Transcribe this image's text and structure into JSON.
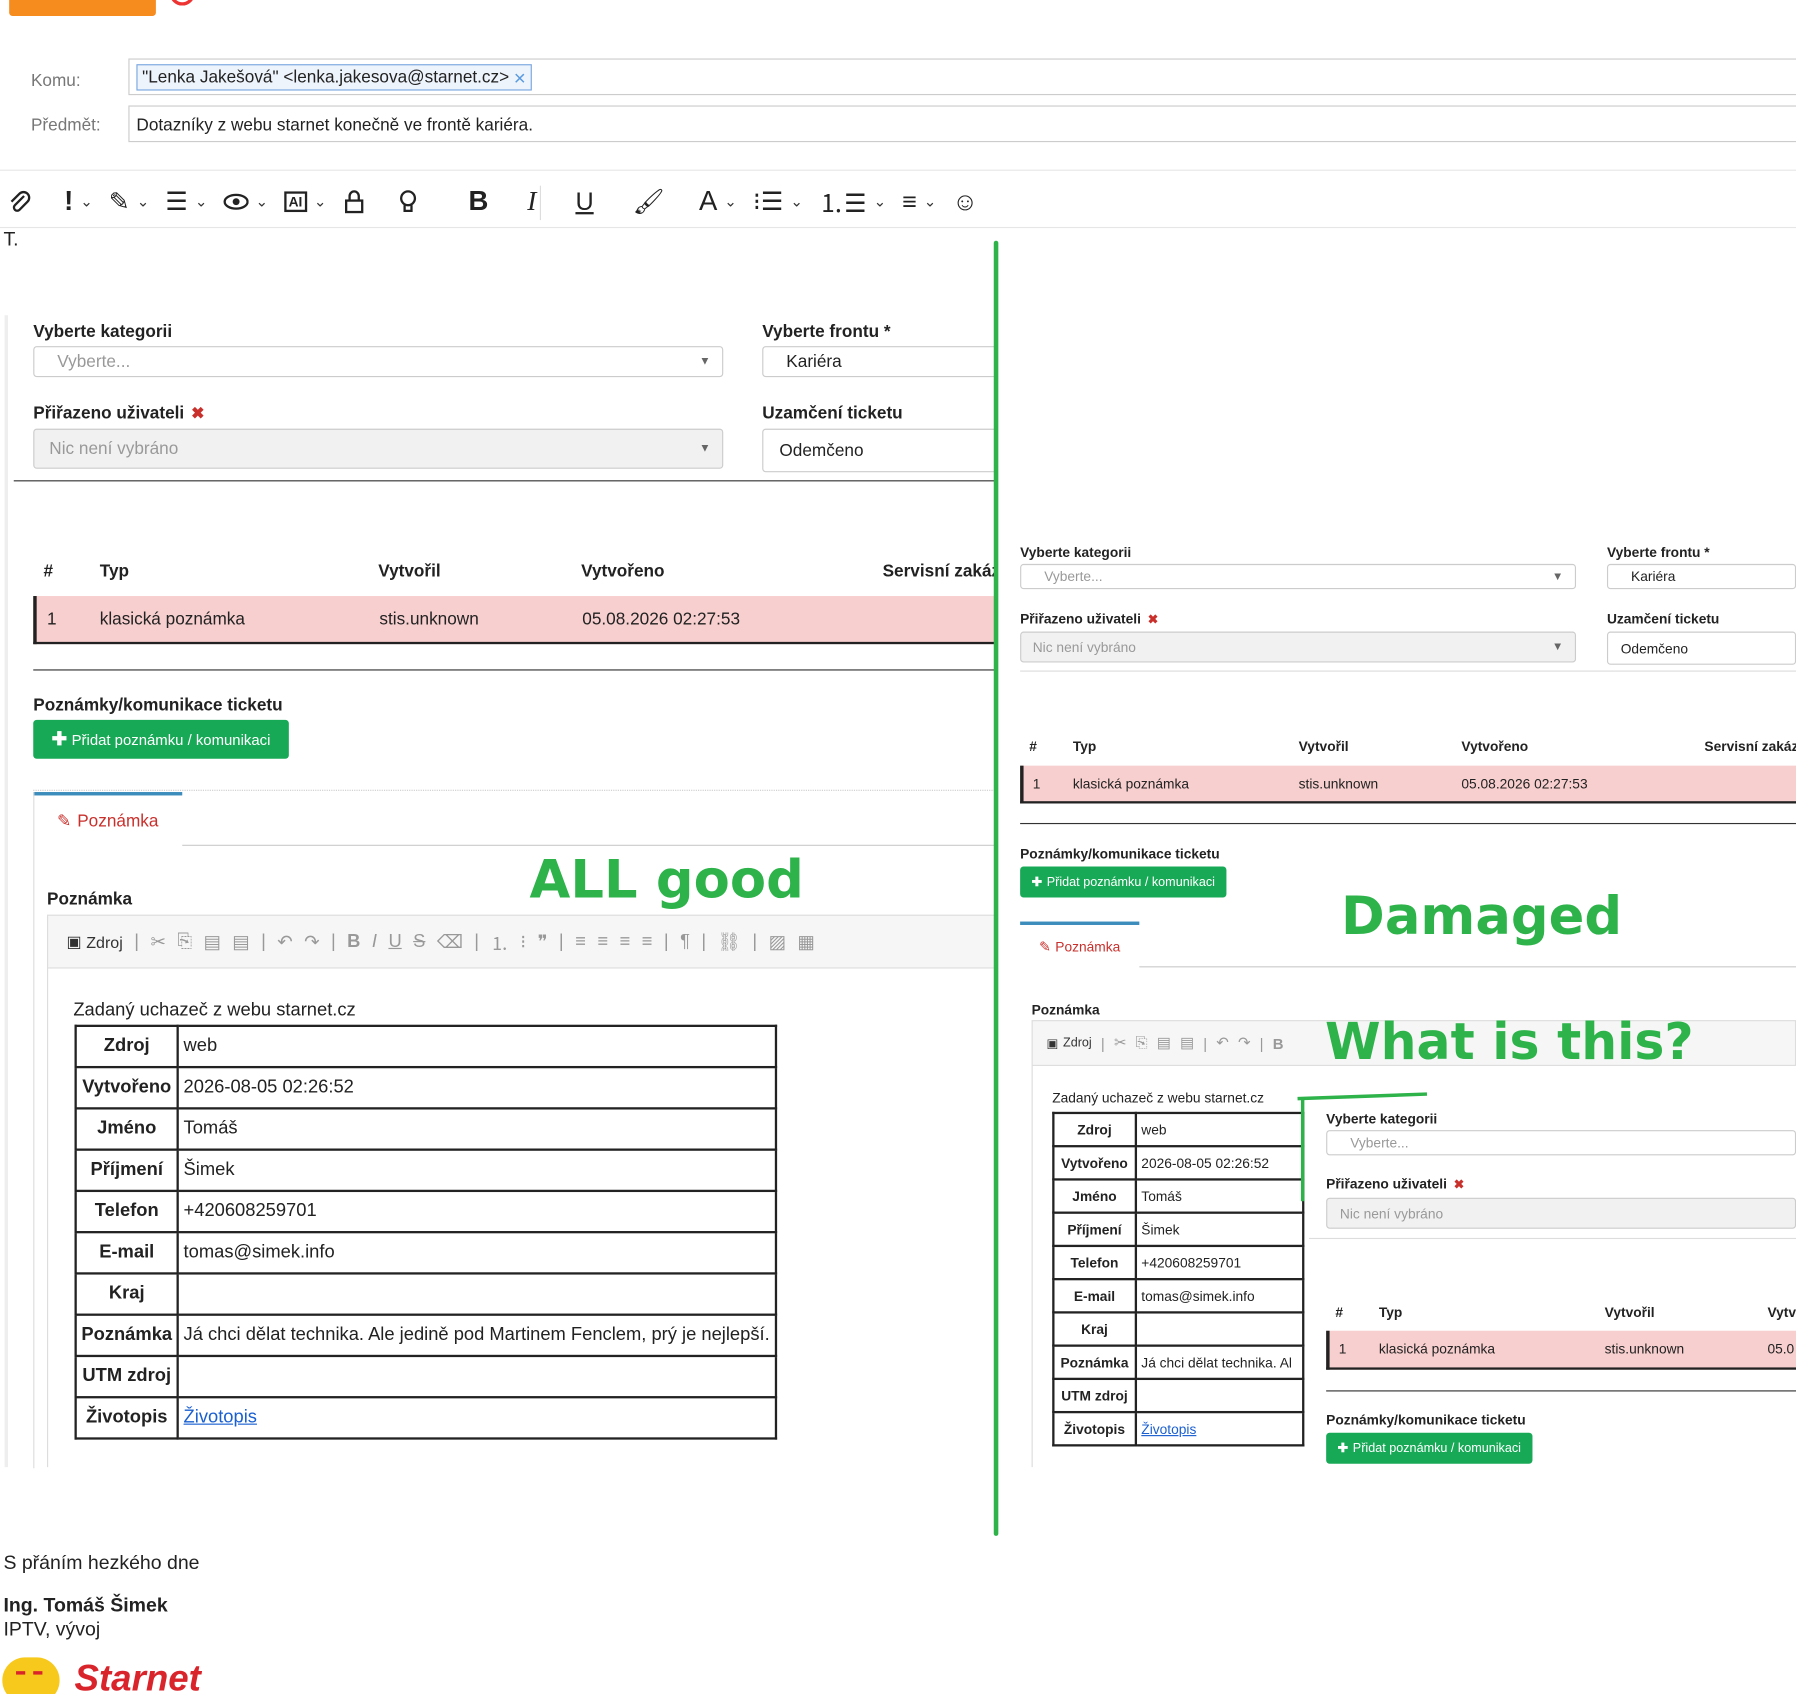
{
  "header": {
    "to_label": "Komu:",
    "to_chip": "\"Lenka Jakešová\" <lenka.jakesova@starnet.cz>",
    "subject_label": "Předmět:",
    "subject_value": "Dotazníky z webu starnet konečně ve frontě kariéra."
  },
  "toolbar": {
    "icons": [
      "paperclip-icon",
      "importance-icon",
      "pen-icon",
      "template-icon",
      "eye-icon",
      "ai-icon",
      "lock-icon",
      "lightbulb-icon",
      "bold-icon",
      "italic-icon",
      "underline-icon",
      "format-painter-icon",
      "font-color-icon",
      "bullet-list-icon",
      "numbered-list-icon",
      "align-icon",
      "emoji-icon"
    ],
    "bold": "B",
    "italic": "I",
    "underline": "U",
    "font": "A"
  },
  "body_start": "T.",
  "left": {
    "cat_label": "Vyberte kategorii",
    "cat_placeholder": "Vyberte...",
    "queue_label": "Vyberte frontu *",
    "queue_value": "Kariéra",
    "assigned_label": "Přiřazeno uživateli",
    "assigned_value": "Nic není vybráno",
    "lock_label": "Uzamčení ticketu",
    "lock_value": "Odemčeno",
    "table_headers": [
      "#",
      "Typ",
      "Vytvořil",
      "Vytvořeno",
      "Servisní zakáz"
    ],
    "row": [
      "1",
      "klasická poznámka",
      "stis.unknown",
      "05.08.2026 02:27:53"
    ],
    "notes_label": "Poznámky/komunikace ticketu",
    "add_button": "Přidat poznámku / komunikaci",
    "tab_label": "Poznámka",
    "note_label": "Poznámka",
    "source_button": "Zdroj",
    "intro": "Zadaný uchazeč z webu starnet.cz"
  },
  "data_table": [
    [
      "Zdroj",
      "web"
    ],
    [
      "Vytvořeno",
      "2026-08-05 02:26:52"
    ],
    [
      "Jméno",
      "Tomáš"
    ],
    [
      "Příjmení",
      "Šimek"
    ],
    [
      "Telefon",
      "+420608259701"
    ],
    [
      "E-mail",
      "tomas@simek.info"
    ],
    [
      "Kraj",
      ""
    ],
    [
      "Poznámka",
      "Já chci dělat technika. Ale jedině pod Martinem Fenclem, prý je nejlepší."
    ],
    [
      "UTM zdroj",
      ""
    ],
    [
      "Životopis",
      "Životopis"
    ]
  ],
  "right": {
    "cat_label": "Vyberte kategorii",
    "cat_placeholder": "Vyberte...",
    "queue_label": "Vyberte frontu *",
    "queue_value": "Kariéra",
    "assigned_label": "Přiřazeno uživateli",
    "assigned_value": "Nic není vybráno",
    "lock_label": "Uzamčení ticketu",
    "lock_value": "Odemčeno",
    "table_headers": [
      "#",
      "Typ",
      "Vytvořil",
      "Vytvořeno",
      "Servisní zakáz"
    ],
    "row": [
      "1",
      "klasická poznámka",
      "stis.unknown",
      "05.08.2026 02:27:53"
    ],
    "notes_label": "Poznámky/komunikace ticketu",
    "add_button": "Přidat poznámku / komunikaci",
    "tab_label": "Poznámka",
    "note_label": "Poznámka",
    "source_button": "Zdroj",
    "intro": "Zadaný uchazeč z webu starnet.cz",
    "data_table": [
      [
        "Zdroj",
        "web"
      ],
      [
        "Vytvořeno",
        "2026-08-05 02:26:52"
      ],
      [
        "Jméno",
        "Tomáš"
      ],
      [
        "Příjmení",
        "Šimek"
      ],
      [
        "Telefon",
        "+420608259701"
      ],
      [
        "E-mail",
        "tomas@simek.info"
      ],
      [
        "Kraj",
        ""
      ],
      [
        "Poznámka",
        "Já chci dělat technika. Al"
      ],
      [
        "UTM zdroj",
        ""
      ],
      [
        "Životopis",
        "Životopis"
      ]
    ],
    "nested": {
      "cat_label": "Vyberte kategorii",
      "cat_placeholder": "Vyberte...",
      "assigned_label": "Přiřazeno uživateli",
      "assigned_value": "Nic není vybráno",
      "table_headers": [
        "#",
        "Typ",
        "Vytvořil",
        "Vytv"
      ],
      "row": [
        "1",
        "klasická poznámka",
        "stis.unknown",
        "05.0"
      ],
      "notes_label": "Poznámky/komunikace ticketu",
      "add_button": "Přidat poznámku / komunikaci"
    }
  },
  "annotations": {
    "good": "ALL good",
    "damaged": "Damaged",
    "question": "What is this?",
    "color": "#2db34a"
  },
  "signature": {
    "greeting": "S přáním hezkého dne",
    "name": "Ing. Tomáš Šimek",
    "role": "IPTV, vývoj",
    "brand": "Starnet",
    "brand_color": "#d9242b"
  }
}
